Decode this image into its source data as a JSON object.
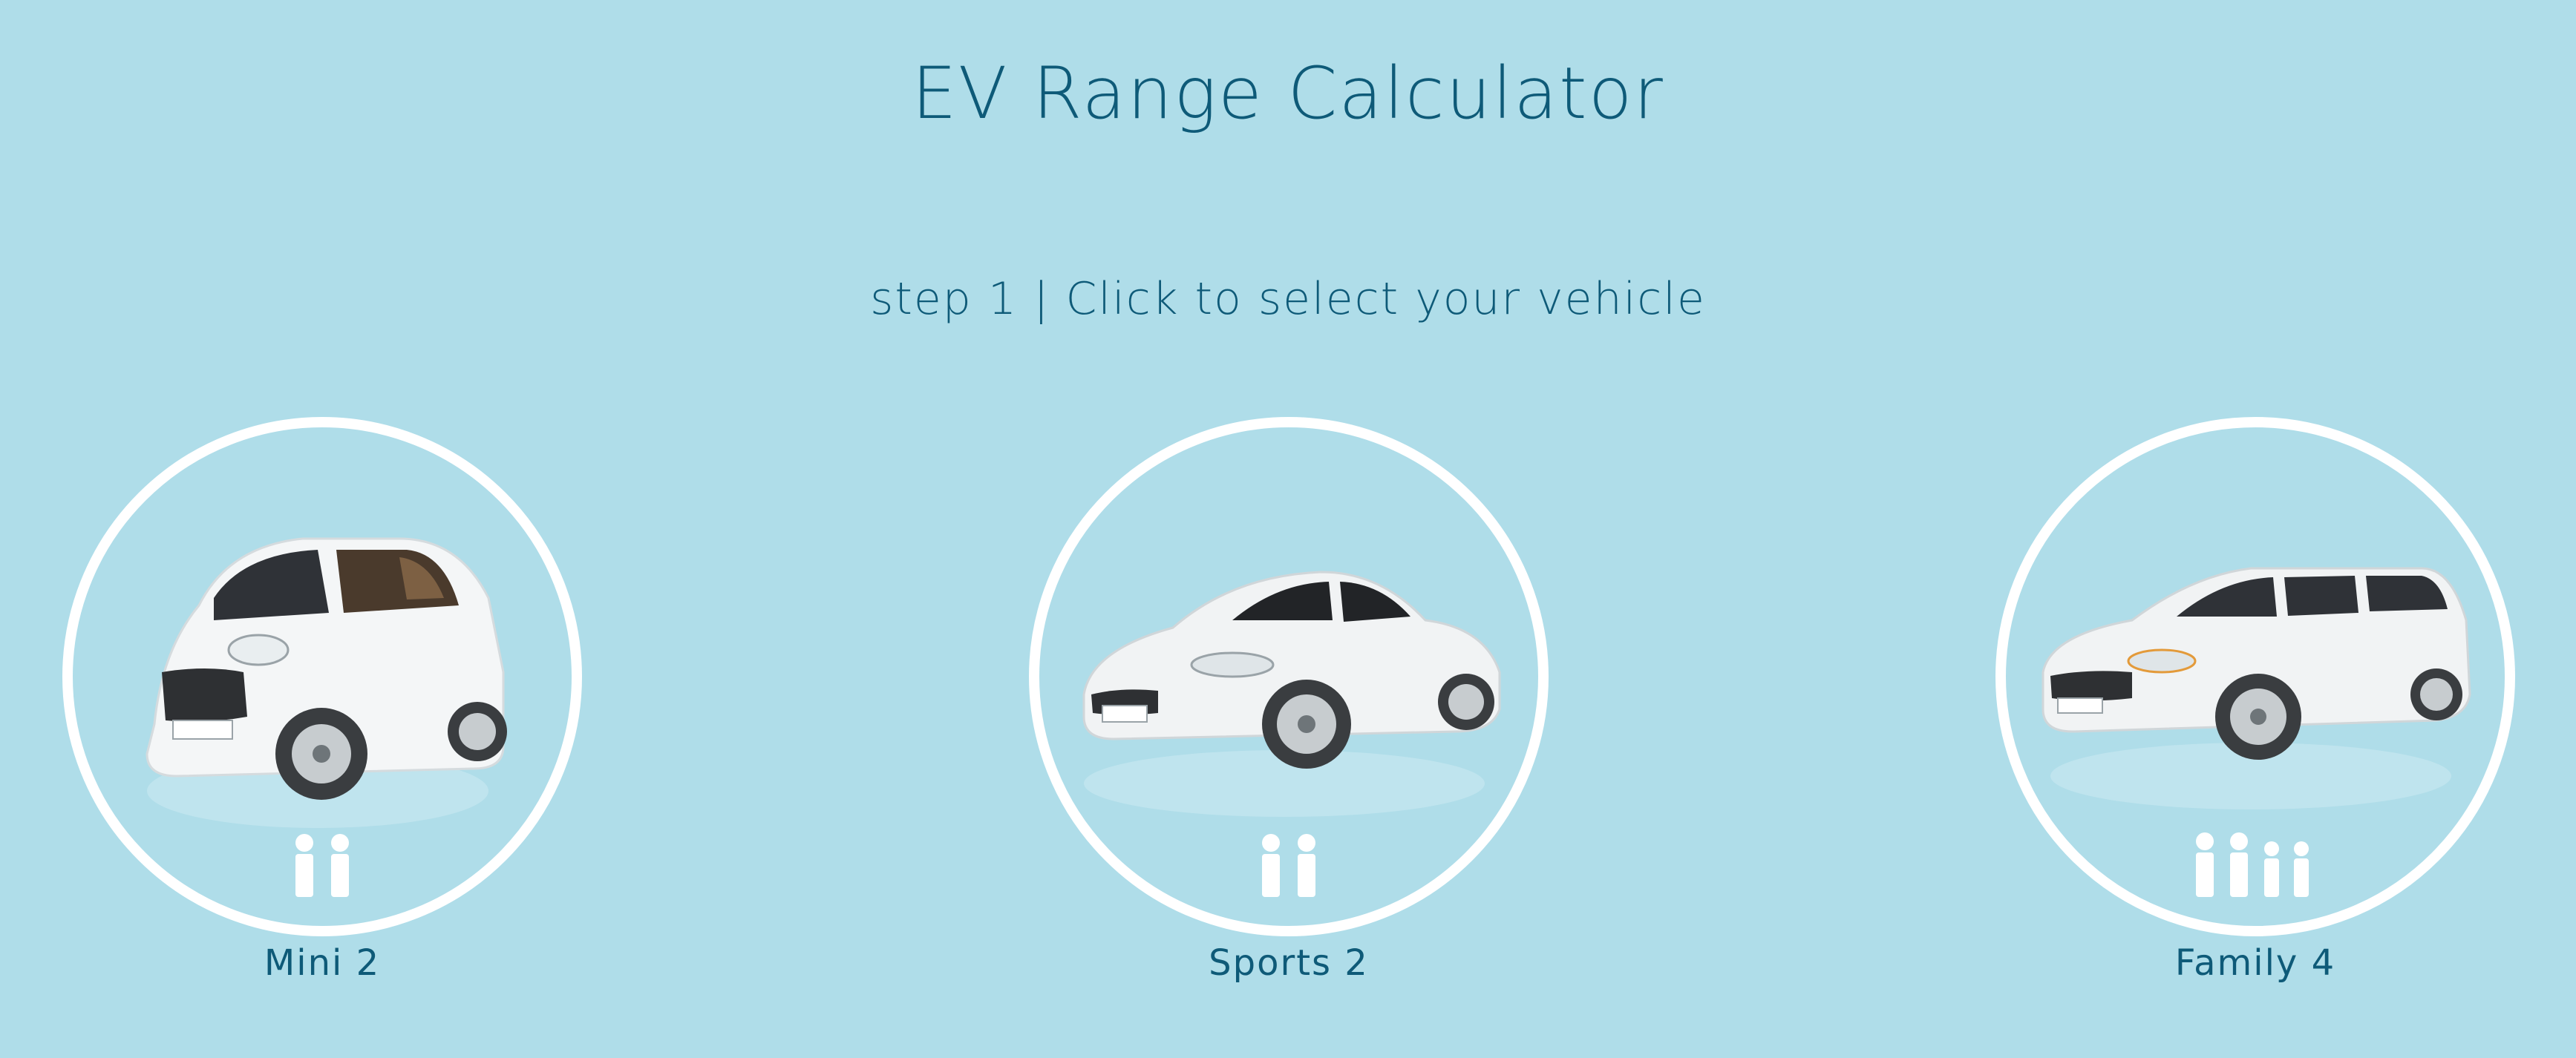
{
  "header": {
    "title": "EV Range Calculator",
    "step_text": "step 1 | Click to select your vehicle"
  },
  "vehicles": [
    {
      "label": "Mini 2",
      "car_icon": "mini-car-icon",
      "passenger_count": 2
    },
    {
      "label": "Sports 2",
      "car_icon": "sports-car-icon",
      "passenger_count": 2
    },
    {
      "label": "Family 4",
      "car_icon": "family-car-icon",
      "passenger_count": 4
    }
  ],
  "colors": {
    "background": "#afdde9",
    "text": "#0e5a78",
    "ring": "#ffffff"
  }
}
